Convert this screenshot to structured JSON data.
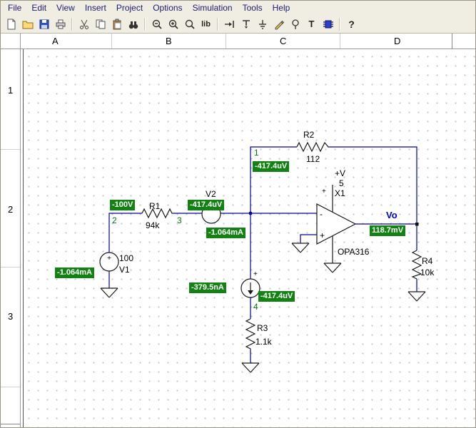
{
  "menu": {
    "items": [
      "File",
      "Edit",
      "View",
      "Insert",
      "Project",
      "Options",
      "Simulation",
      "Tools",
      "Help"
    ]
  },
  "toolbar": {
    "lib_label": "lib",
    "text_tool_label": "T",
    "help_label": "?",
    "icons": [
      "new-document",
      "open",
      "save",
      "print",
      "cut",
      "copy",
      "paste",
      "find",
      "zoom-out",
      "zoom-in",
      "zoom",
      "library",
      "wire-tool",
      "jumper-tool",
      "ground-tool",
      "pen-tool",
      "voltage-pin-tool",
      "text-tool",
      "macro-tool",
      "help"
    ]
  },
  "ruler": {
    "columns": [
      "A",
      "B",
      "C",
      "D"
    ],
    "rows": [
      "1",
      "2",
      "3"
    ]
  },
  "circuit": {
    "r1": {
      "ref": "R1",
      "value": "94k"
    },
    "r2": {
      "ref": "R2",
      "value": "112"
    },
    "r3": {
      "ref": "R3",
      "value": "1.1k"
    },
    "r4": {
      "ref": "R4",
      "value": "10k"
    },
    "v1": {
      "ref": "V1",
      "value": "100"
    },
    "v2": {
      "ref": "V2"
    },
    "opamp": {
      "ref": "X1",
      "part": "OPA316",
      "supply_label": "+V",
      "supply_pin": "5"
    },
    "output": {
      "label": "Vo"
    },
    "nodes": {
      "n1": "1",
      "n2": "2",
      "n3": "3",
      "n4": "4"
    },
    "meters": {
      "v1_current": "-1.064mA",
      "input_voltage": "-100V",
      "v2_voltage": "-417.4uV",
      "series_current": "-1.064mA",
      "node1_voltage": "-417.4uV",
      "probe_current": "-379.5nA",
      "probe_voltage": "-417.4uV",
      "output_voltage": "118.7mV"
    },
    "symbols": {
      "plus": "+",
      "minus": "-"
    }
  },
  "colors": {
    "badge_bg": "#128312",
    "badge_text": "#ffffff",
    "wire": "#0000a2",
    "node_text": "#007b00",
    "vo_text": "#0000cc",
    "menu_text": "#1b1b70"
  }
}
